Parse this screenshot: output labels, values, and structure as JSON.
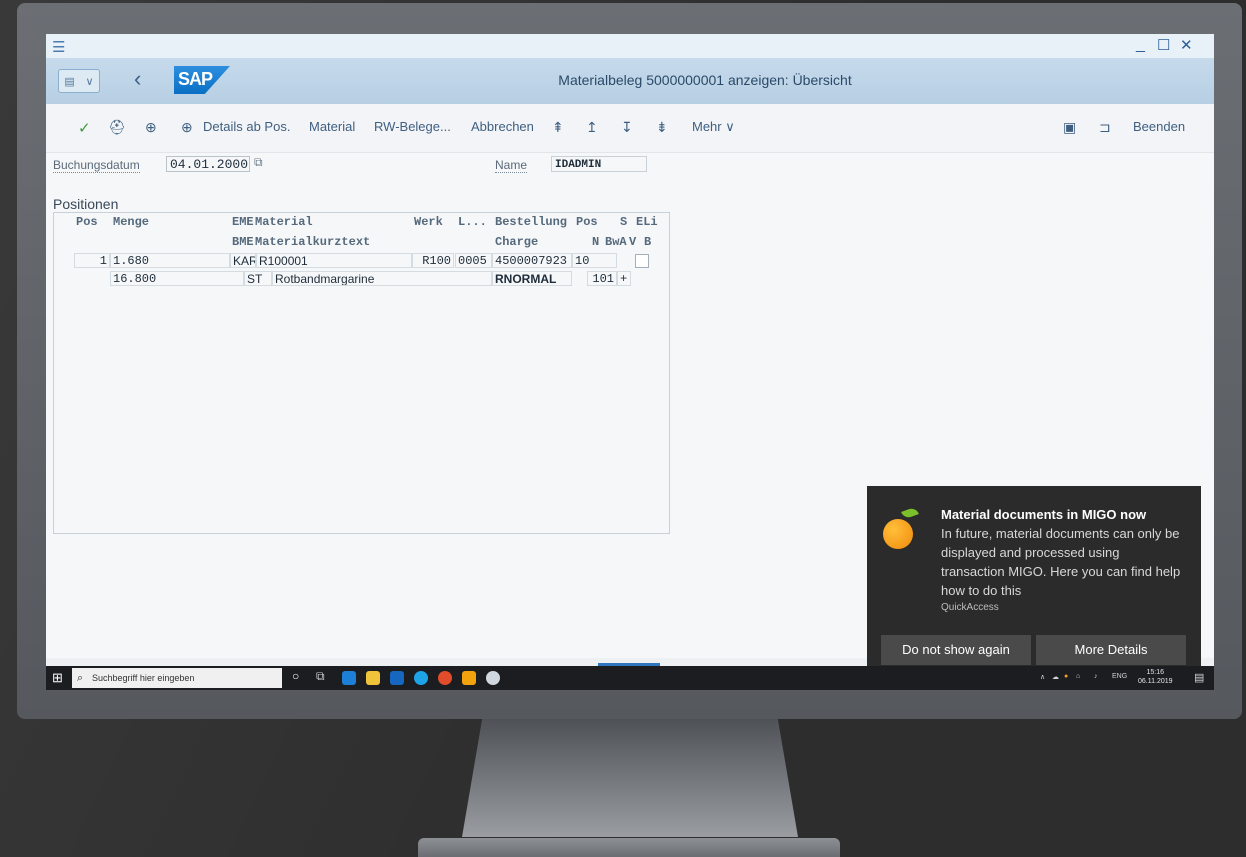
{
  "window": {
    "menu_icon": "hamburger-icon",
    "minimize": "_",
    "maximize": "☐",
    "close": "✕"
  },
  "header": {
    "title": "Materialbeleg 5000000001 anzeigen: Übersicht",
    "logo_text": "SAP",
    "back_icon": "‹"
  },
  "toolbar": {
    "items": [
      "Details ab Pos.",
      "Material",
      "RW-Belege...",
      "Abbrechen",
      "Mehr"
    ],
    "end_label": "Beenden"
  },
  "form": {
    "posting_date_label": "Buchungsdatum",
    "posting_date_value": "04.01.2000",
    "name_label": "Name",
    "name_value": "IDADMIN"
  },
  "positions": {
    "section_title": "Positionen",
    "header_row1": [
      "Pos",
      "Menge",
      "EME",
      "Material",
      "Werk",
      "L...",
      "Bestellung",
      "Pos",
      "S",
      "ELi"
    ],
    "header_row2": [
      "BME",
      "Materialkurztext",
      "Charge",
      "N",
      "BwA",
      "V",
      "B"
    ],
    "row1": {
      "pos": "1",
      "menge": "1.680",
      "eme": "KAR",
      "material": "R100001",
      "werk": "R100",
      "lager": "0005",
      "bestellung": "4500007923",
      "bestpos": "10"
    },
    "row2": {
      "menge": "16.800",
      "bme": "ST",
      "kurztext": "Rotbandmargarine",
      "charge": "RNORMAL",
      "bwa": "101",
      "sign": "+"
    }
  },
  "taskbar": {
    "search_placeholder": "Suchbegriff hier eingeben",
    "lang": "ENG",
    "time": "15:16",
    "date": "06.11.2019"
  },
  "notification": {
    "title": "Material documents in MIGO now",
    "body": "In future, material documents can only be displayed and processed using transaction MIGO. Here you can find help how to do this",
    "source": "QuickAccess",
    "btn_dismiss": "Do not show again",
    "btn_details": "More Details"
  }
}
